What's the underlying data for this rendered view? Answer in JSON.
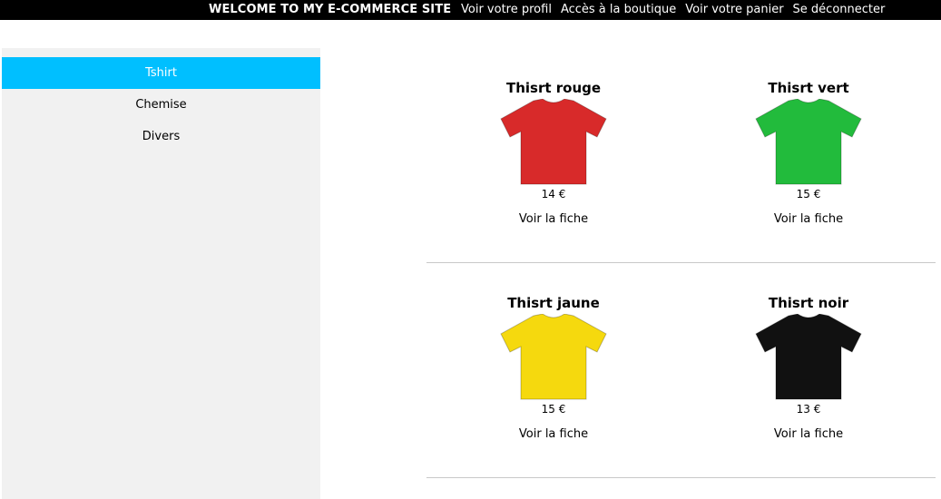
{
  "header": {
    "brand": "WELCOME TO MY E-COMMERCE SITE",
    "nav": [
      {
        "label": "Voir votre profil"
      },
      {
        "label": "Accès à la boutique"
      },
      {
        "label": "Voir votre panier"
      },
      {
        "label": "Se déconnecter"
      }
    ]
  },
  "sidebar": {
    "items": [
      {
        "label": "Tshirt",
        "active": true
      },
      {
        "label": "Chemise",
        "active": false
      },
      {
        "label": "Divers",
        "active": false
      }
    ],
    "active_color": "#00bfff"
  },
  "products": [
    {
      "name": "Thisrt rouge",
      "price": "14 €",
      "link": "Voir la fiche",
      "color": "#d82a2a"
    },
    {
      "name": "Thisrt vert",
      "price": "15 €",
      "link": "Voir la fiche",
      "color": "#22bb3c"
    },
    {
      "name": "Thisrt jaune",
      "price": "15 €",
      "link": "Voir la fiche",
      "color": "#f5d90e"
    },
    {
      "name": "Thisrt noir",
      "price": "13 €",
      "link": "Voir la fiche",
      "color": "#111111"
    }
  ]
}
